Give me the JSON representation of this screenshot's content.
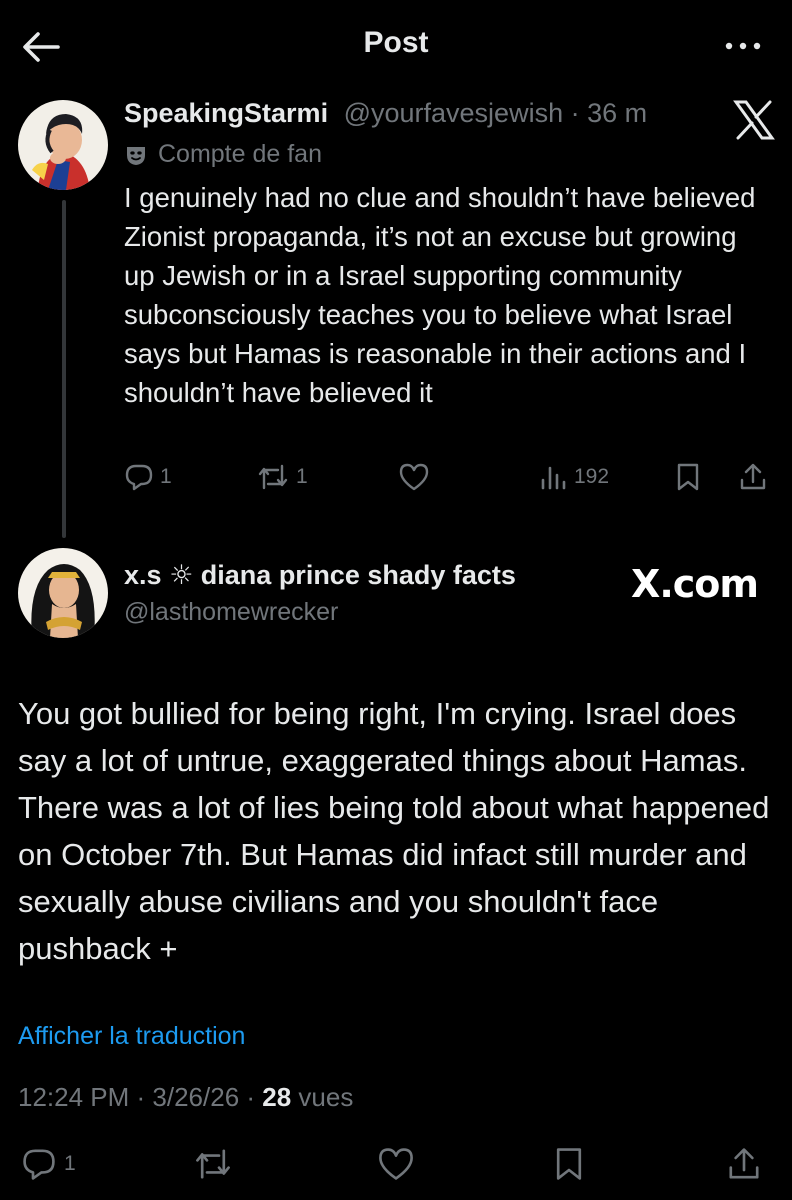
{
  "header": {
    "title": "Post"
  },
  "tweet1": {
    "display_name": "SpeakingStarmi",
    "handle": "@yourfavesjewish",
    "separator": " · ",
    "time": "36 m",
    "fan_label": "Compte de fan",
    "text": "I genuinely had no clue and shouldn’t have believed Zionist propaganda, it’s not an excuse but growing up Jewish or in a Israel supporting community subconsciously teaches you to believe what Israel says but Hamas is reasonable in their actions and I shouldn’t have believed it",
    "replies": "1",
    "reposts": "1",
    "views": "192"
  },
  "tweet2": {
    "display_name_a": "x.s",
    "display_name_symbol": "☼",
    "display_name_b": "diana prince shady facts",
    "handle": "@lasthomewrecker",
    "watermark": "X.com",
    "text": "You got bullied for being right, I'm crying. Israel does say a lot of untrue, exaggerated things about Hamas. There was a lot of lies being told about what happened on October 7th. But Hamas did infact still murder and sexually abuse civilians and you shouldn't face pushback +",
    "translate_link": "Afficher la traduction",
    "time": "12:24 PM",
    "sep": " · ",
    "date": "3/26/26",
    "sep2": " · ",
    "views_count": "28",
    "views_label": " vues",
    "replies": "1"
  },
  "colors": {
    "background": "#000000",
    "text": "#e7e9ea",
    "muted": "#71767b",
    "link": "#1d9bf0"
  },
  "icons": [
    "back-arrow-icon",
    "more-icon",
    "x-logo-icon",
    "mask-icon",
    "reply-icon",
    "repost-icon",
    "like-icon",
    "views-icon",
    "bookmark-icon",
    "share-icon"
  ]
}
